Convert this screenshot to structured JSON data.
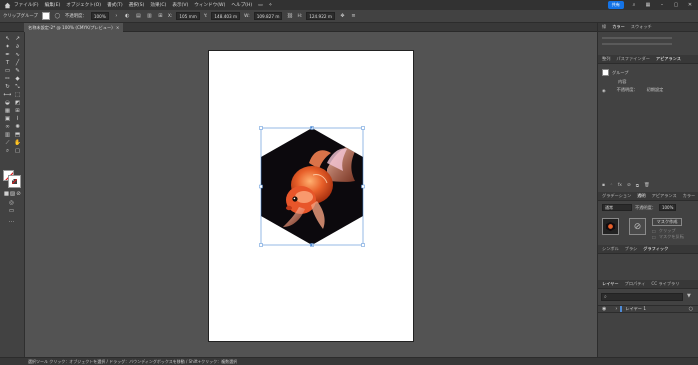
{
  "menubar": {
    "items": [
      "ファイル(F)",
      "編集(E)",
      "オブジェクト(O)",
      "書式(T)",
      "選択(S)",
      "効果(C)",
      "表示(V)",
      "ウィンドウ(W)",
      "ヘルプ(H)"
    ],
    "share_label": "共有"
  },
  "controlbar": {
    "object_type": "クリップグループ",
    "opacity_label": "不透明度：",
    "opacity_value": "100%",
    "x_label": "X:",
    "x_value": "105 mm",
    "y_label": "Y:",
    "y_value": "148.403 m",
    "w_label": "W:",
    "w_value": "109.827 m",
    "h_label": "H:",
    "h_value": "124.922 m"
  },
  "document_tab": {
    "title": "名称未設定-2* @ 100% (CMYK/プレビュー)",
    "close_label": "×"
  },
  "right_panel": {
    "top_tabs": [
      "線",
      "カラー",
      "スウォッチ"
    ],
    "section_tabs": [
      "整列",
      "パスファインダー",
      "アピアランス"
    ],
    "appearance_group_label": "グループ",
    "appearance_contents_label": "内容",
    "appearance_opacity_label": "不透明度：",
    "appearance_opacity_value": "初期設定",
    "transparency_tabs": [
      "グラデーション",
      "透明",
      "アピアランス",
      "カラー"
    ],
    "blend_mode": "通常",
    "opacity_label": "不透明度：",
    "opacity_value": "100%",
    "mask_button_label": "マスク作成",
    "clip_option": "クリップ",
    "invert_option": "マスクを反転",
    "lower_tabs": [
      "シンボル",
      "ブラシ",
      "グラフィック"
    ],
    "layers_tabs": [
      "レイヤー",
      "プロパティ",
      "CC ライブラリ"
    ],
    "layer_name": "レイヤー 1"
  },
  "statusbar": {
    "text": "選択ツール クリック：オブジェクトを選択 / ドラッグ：バウンディングボックスを移動 / Shift+クリック：複数選択"
  }
}
